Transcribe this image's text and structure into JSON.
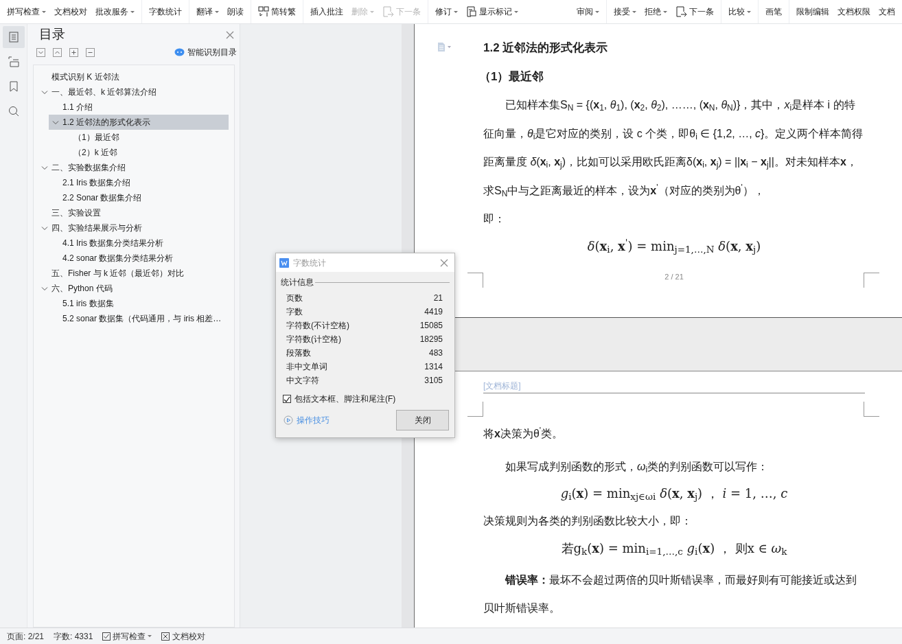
{
  "toolbar": {
    "left_groups": [
      [
        {
          "label": "拼写检查",
          "kind": "plain",
          "dropdown": true,
          "disabled": false
        },
        {
          "label": "文档校对",
          "kind": "plain",
          "dropdown": false,
          "disabled": false
        },
        {
          "label": "批改服务",
          "kind": "plain",
          "dropdown": true,
          "disabled": false
        }
      ],
      [
        {
          "label": "字数统计",
          "kind": "plain",
          "dropdown": false,
          "disabled": false
        }
      ],
      [
        {
          "label": "翻译",
          "kind": "plain",
          "dropdown": true,
          "disabled": false
        },
        {
          "label": "朗读",
          "kind": "plain",
          "dropdown": false,
          "disabled": false
        }
      ],
      [
        {
          "label": "简转繁",
          "kind": "convert",
          "dropdown": false,
          "disabled": false
        }
      ],
      [
        {
          "label": "插入批注",
          "kind": "plain",
          "dropdown": false,
          "disabled": false
        },
        {
          "label": "删除",
          "kind": "plain",
          "dropdown": true,
          "disabled": true
        },
        {
          "label": "下一条",
          "kind": "next",
          "dropdown": false,
          "disabled": true
        }
      ],
      [
        {
          "label": "修订",
          "kind": "plain",
          "dropdown": true,
          "disabled": false
        },
        {
          "label": "显示标记",
          "kind": "markup",
          "dropdown": true,
          "disabled": false
        }
      ]
    ],
    "right_groups": [
      [
        {
          "label": "审阅",
          "kind": "plain",
          "dropdown": true,
          "disabled": false
        }
      ],
      [
        {
          "label": "接受",
          "kind": "plain",
          "dropdown": true,
          "disabled": false
        },
        {
          "label": "拒绝",
          "kind": "plain",
          "dropdown": true,
          "disabled": false
        },
        {
          "label": "下一条",
          "kind": "next",
          "dropdown": false,
          "disabled": false
        }
      ],
      [
        {
          "label": "比较",
          "kind": "plain",
          "dropdown": true,
          "disabled": false
        }
      ],
      [
        {
          "label": "画笔",
          "kind": "plain",
          "dropdown": false,
          "disabled": false
        }
      ],
      [
        {
          "label": "限制编辑",
          "kind": "plain",
          "dropdown": false,
          "disabled": false
        },
        {
          "label": "文档权限",
          "kind": "plain",
          "dropdown": false,
          "disabled": false
        },
        {
          "label": "文档",
          "kind": "plain",
          "dropdown": false,
          "disabled": false
        }
      ]
    ]
  },
  "icon_rail": [
    {
      "kind": "outline",
      "selected": true
    },
    {
      "kind": "navigation",
      "selected": false
    },
    {
      "kind": "bookmark",
      "selected": false
    },
    {
      "kind": "search",
      "selected": false
    }
  ],
  "outline": {
    "title": "目录",
    "smart_button": "智能识别目录",
    "items": [
      {
        "label": "模式识别  K 近邻法",
        "selected": false
      },
      {
        "label": "一、最近邻、k 近邻算法介绍",
        "selected": false,
        "expanded": true,
        "children": [
          {
            "label": "1.1  介绍",
            "selected": false
          },
          {
            "label": "1.2  近邻法的形式化表示",
            "selected": true,
            "expanded": true,
            "children": [
              {
                "label": "（1）最近邻",
                "selected": false
              },
              {
                "label": "（2）k 近邻",
                "selected": false
              }
            ]
          }
        ]
      },
      {
        "label": "二、实验数据集介绍",
        "selected": false,
        "expanded": true,
        "children": [
          {
            "label": "2.1 Iris 数据集介绍",
            "selected": false
          },
          {
            "label": "2.2 Sonar 数据集介绍",
            "selected": false
          }
        ]
      },
      {
        "label": "三、实验设置",
        "selected": false
      },
      {
        "label": "四、实验结果展示与分析",
        "selected": false,
        "expanded": true,
        "children": [
          {
            "label": "4.1 Iris 数据集分类结果分析",
            "selected": false
          },
          {
            "label": "4.2 sonar 数据集分类结果分析",
            "selected": false
          }
        ]
      },
      {
        "label": "五、Fisher 与 k 近邻（最近邻）对比",
        "selected": false
      },
      {
        "label": "六、Python 代码",
        "selected": false,
        "expanded": true,
        "children": [
          {
            "label": "5.1 iris 数据集",
            "selected": false
          },
          {
            "label": "5.2 sonar 数据集（代码通用，与 iris 相差…",
            "selected": false
          }
        ]
      }
    ]
  },
  "page_1": {
    "blocks": [
      {
        "kind": "heading",
        "text": "1.2  近邻法的形式化表示"
      },
      {
        "kind": "subheading",
        "text": "（1）最近邻"
      },
      {
        "kind": "para",
        "text": "已知样本集S$_{N}$ = {(**x**$_{1}$, *θ*$_{1}$), (**x**$_{2}$, *θ*$_{2}$), ……, (**x**$_{N}$, *θ*$_{N}$)}，其中，*x*$_{i}$是样本 i 的特征向量，*θ*$_{i}$是它对应的类别，设 c 个类，即θ$_{i}$ ∈ {1,2, …, *c*}。定义两个样本简得距离量度 *δ*(**x**$_{i}$, **x**$_{j}$)，比如可以采用欧氏距离δ(**x**$_{i}$, **x**$_{j}$) = ||**x**$_{i}$ − **x**$_{j}$||。对未知样本**x**，求S$_{N}$中与之距离最近的样本，设为**x**$^{'}$（对应的类别为θ$^{'}$），"
      },
      {
        "kind": "line",
        "text": "即："
      },
      {
        "kind": "formula",
        "text": "*δ*(**x**$_{i}$, **x**$^{'}$) = min$_{j=1,…,N}$ *δ*(**x**, **x**$_{j}$)"
      }
    ],
    "page_number": "2 / 21"
  },
  "page_2": {
    "header": "[文档标题]",
    "blocks": [
      {
        "kind": "line",
        "text": "将**x**决策为θ$^{'}$类。"
      },
      {
        "kind": "para",
        "text": "如果写成判别函数的形式，*ω*$_{i}$类的判别函数可以写作："
      },
      {
        "kind": "formula",
        "text": "*g*$_{i}$(**x**) = min$_{xj∈ωi}$ *δ*(**x**, **x**$_{j}$)  ，  *i* = 1, …, *c*"
      },
      {
        "kind": "line",
        "text": "决策规则为各类的判别函数比较大小，即："
      },
      {
        "kind": "formula",
        "text": "若g$_{k}$(**x**) = min$_{i=1,…,c}$ *g*$_{i}$(**x**)  ，  则x ∈ *ω*$_{k}$"
      },
      {
        "kind": "para",
        "text": "**错误率：**最坏不会超过两倍的贝叶斯错误率，而最好则有可能接近或达到贝叶斯错误率。"
      }
    ]
  },
  "dialog": {
    "title": "字数统计",
    "section": "统计信息",
    "rows": [
      {
        "label": "页数",
        "value": "21"
      },
      {
        "label": "字数",
        "value": "4419"
      },
      {
        "label": "字符数(不计空格)",
        "value": "15085"
      },
      {
        "label": "字符数(计空格)",
        "value": "18295"
      },
      {
        "label": "段落数",
        "value": "483"
      },
      {
        "label": "非中文单词",
        "value": "1314"
      },
      {
        "label": "中文字符",
        "value": "3105"
      }
    ],
    "checkbox": {
      "label": "包括文本框、脚注和尾注(F)",
      "checked": true
    },
    "tips_link": "操作技巧",
    "close_button": "关闭"
  },
  "status_bar": {
    "page": "页面: 2/21",
    "words": "字数: 4331",
    "spell_check": {
      "label": "拼写检查",
      "dropdown": true
    },
    "proofread": "文档校对"
  }
}
